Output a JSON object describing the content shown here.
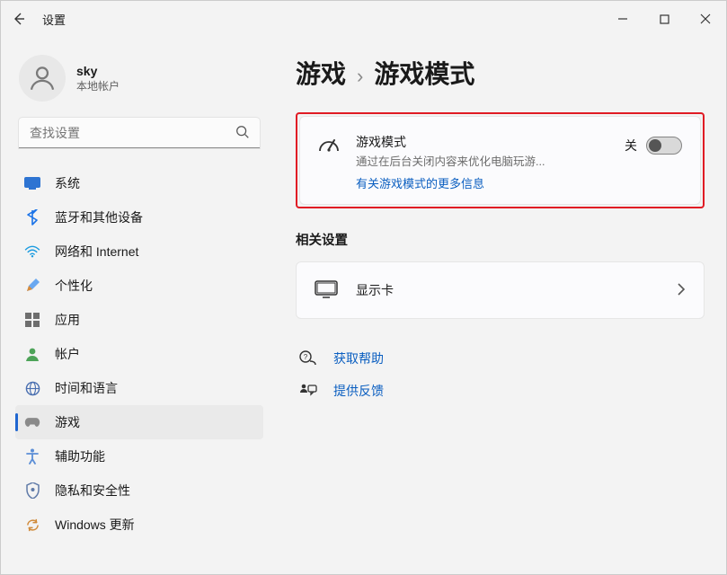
{
  "window": {
    "app_title": "设置"
  },
  "user": {
    "name": "sky",
    "subtitle": "本地帐户"
  },
  "search": {
    "placeholder": "查找设置"
  },
  "sidebar": {
    "items": [
      {
        "icon": "system-icon",
        "label": "系统"
      },
      {
        "icon": "bluetooth-icon",
        "label": "蓝牙和其他设备"
      },
      {
        "icon": "network-icon",
        "label": "网络和 Internet"
      },
      {
        "icon": "personalize-icon",
        "label": "个性化"
      },
      {
        "icon": "apps-icon",
        "label": "应用"
      },
      {
        "icon": "accounts-icon",
        "label": "帐户"
      },
      {
        "icon": "time-lang-icon",
        "label": "时间和语言"
      },
      {
        "icon": "gaming-icon",
        "label": "游戏"
      },
      {
        "icon": "accessibility-icon",
        "label": "辅助功能"
      },
      {
        "icon": "privacy-icon",
        "label": "隐私和安全性"
      },
      {
        "icon": "update-icon",
        "label": "Windows 更新"
      }
    ],
    "active_index": 7
  },
  "breadcrumb": {
    "parent": "游戏",
    "current": "游戏模式"
  },
  "game_mode_card": {
    "title": "游戏模式",
    "desc": "通过在后台关闭内容来优化电脑玩游...",
    "link": "有关游戏模式的更多信息",
    "state_label": "关",
    "toggle_on": false
  },
  "related": {
    "heading": "相关设置",
    "display_label": "显示卡"
  },
  "footer": {
    "help": "获取帮助",
    "feedback": "提供反馈"
  }
}
